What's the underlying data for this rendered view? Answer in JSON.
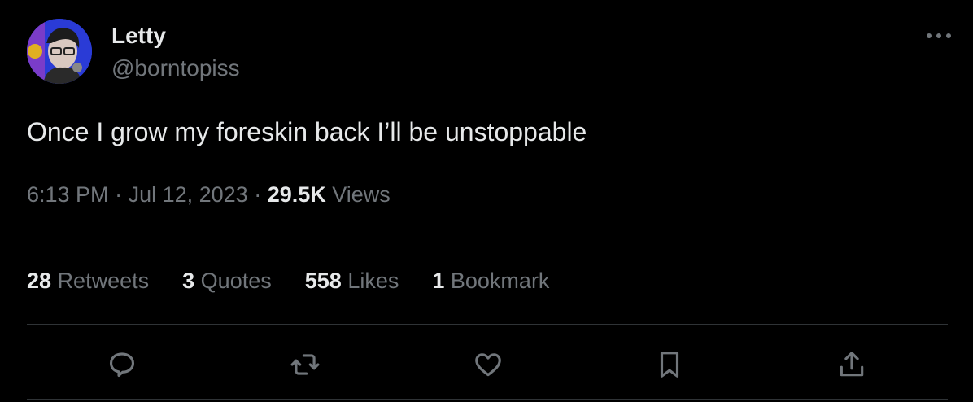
{
  "author": {
    "display_name": "Letty",
    "handle": "@borntopiss"
  },
  "tweet": {
    "text": "Once I grow my foreskin back I’ll be unstoppable",
    "time": "6:13 PM",
    "date": "Jul 12, 2023",
    "views_count": "29.5K",
    "views_label": "Views"
  },
  "stats": {
    "retweets_count": "28",
    "retweets_label": "Retweets",
    "quotes_count": "3",
    "quotes_label": "Quotes",
    "likes_count": "558",
    "likes_label": "Likes",
    "bookmarks_count": "1",
    "bookmarks_label": "Bookmark"
  },
  "icons": {
    "more": "more-horizontal-icon",
    "reply": "reply-icon",
    "retweet": "retweet-icon",
    "like": "heart-icon",
    "bookmark": "bookmark-icon",
    "share": "share-icon"
  },
  "colors": {
    "background": "#000000",
    "primary_text": "#e7e9ea",
    "secondary_text": "#71767b",
    "divider": "#2f3336"
  }
}
